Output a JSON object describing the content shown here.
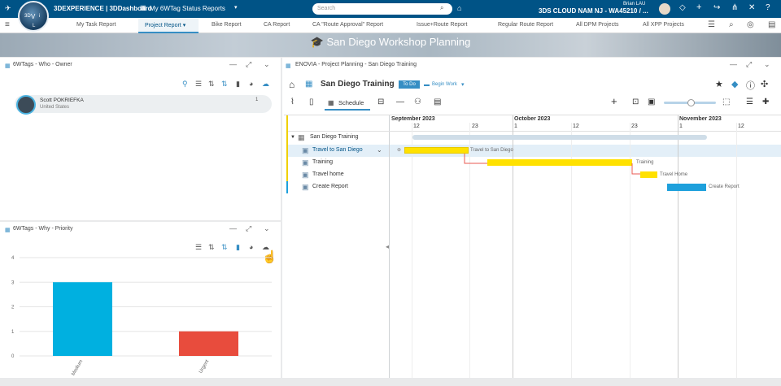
{
  "topbar": {
    "brand": "3DEXPERIENCE | 3DDashboard",
    "dashboard": "My 6WTag Status Reports",
    "search_placeholder": "Search",
    "cloud": "3DS CLOUD NAM NJ - WA45210 / ...",
    "user": "Brian LAU",
    "compass_labels": [
      "3D",
      "V",
      "i",
      "L"
    ]
  },
  "tabs": [
    "My Task Report",
    "Project Report",
    "Bike Report",
    "CA Report",
    "CA \"Route Approval\" Report",
    "Issue+Route Report",
    "Regular Route Report",
    "All DPM Projects",
    "All XPP Projects"
  ],
  "banner": {
    "title": "San Diego Workshop Planning"
  },
  "who": {
    "title": "6WTags - Who - Owner",
    "name": "Scott POKRIEFKA",
    "country": "United States",
    "count": "1"
  },
  "why": {
    "title": "6WTags - Why - Priority"
  },
  "chart_data": {
    "type": "bar",
    "categories": [
      "Medium",
      "Urgent"
    ],
    "values": [
      3,
      1
    ],
    "colors": [
      "#00b0e0",
      "#e84c3d"
    ],
    "yticks": [
      "4",
      "3",
      "2",
      "1",
      "0"
    ],
    "ylim": [
      0,
      4
    ]
  },
  "project": {
    "title": "ENOVIA - Project Planning - San Diego Training",
    "name": "San Diego Training",
    "status": "To Do",
    "action": "Begin Work",
    "tab": "Schedule"
  },
  "gantt": {
    "months": [
      "September 2023",
      "October 2023",
      "November 2023"
    ],
    "days": [
      "12",
      "23",
      "1",
      "12",
      "23",
      "1",
      "12"
    ],
    "rows": [
      {
        "label": "San Diego Training",
        "bar_label": ""
      },
      {
        "label": "Travel to San Diego",
        "bar_label": "Travel to San Diego"
      },
      {
        "label": "Training",
        "bar_label": "Training"
      },
      {
        "label": "Travel home",
        "bar_label": "Travel Home"
      },
      {
        "label": "Create Report",
        "bar_label": "Create Report"
      }
    ]
  }
}
